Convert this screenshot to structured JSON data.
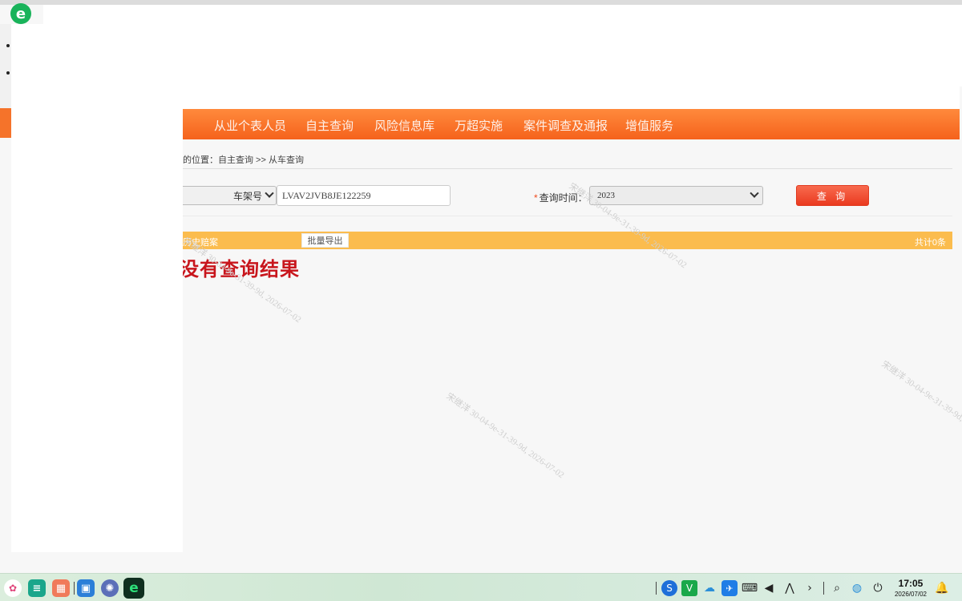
{
  "nav": {
    "items": [
      {
        "label": "从业个表人员"
      },
      {
        "label": "自主查询"
      },
      {
        "label": "风险信息库"
      },
      {
        "label": "万超实施"
      },
      {
        "label": "案件调查及通报"
      },
      {
        "label": "增值服务"
      }
    ]
  },
  "breadcrumb": "的位置：自主查询 >> 从车查询",
  "search": {
    "field_type": "车架号",
    "vin_value": "LVAV2JVB8JE122259",
    "date_label": "查询时间：",
    "date_required_mark": "*",
    "date_value": "2023",
    "query_button": "查 询"
  },
  "results": {
    "history_label": "历史赔案",
    "export_button": "批量导出",
    "total": "共计0条",
    "no_result": "没有查询结果"
  },
  "watermark_text": "宋继洋  30-04-9e-31-39-9d, 2026-07-02",
  "taskbar": {
    "time": "17:05",
    "date": "2026/07/02"
  },
  "colors": {
    "nav_orange": "#f5621c",
    "result_bar": "#fbbc4e",
    "query_button": "#ea3a1f",
    "no_result_text": "#c8161d"
  }
}
